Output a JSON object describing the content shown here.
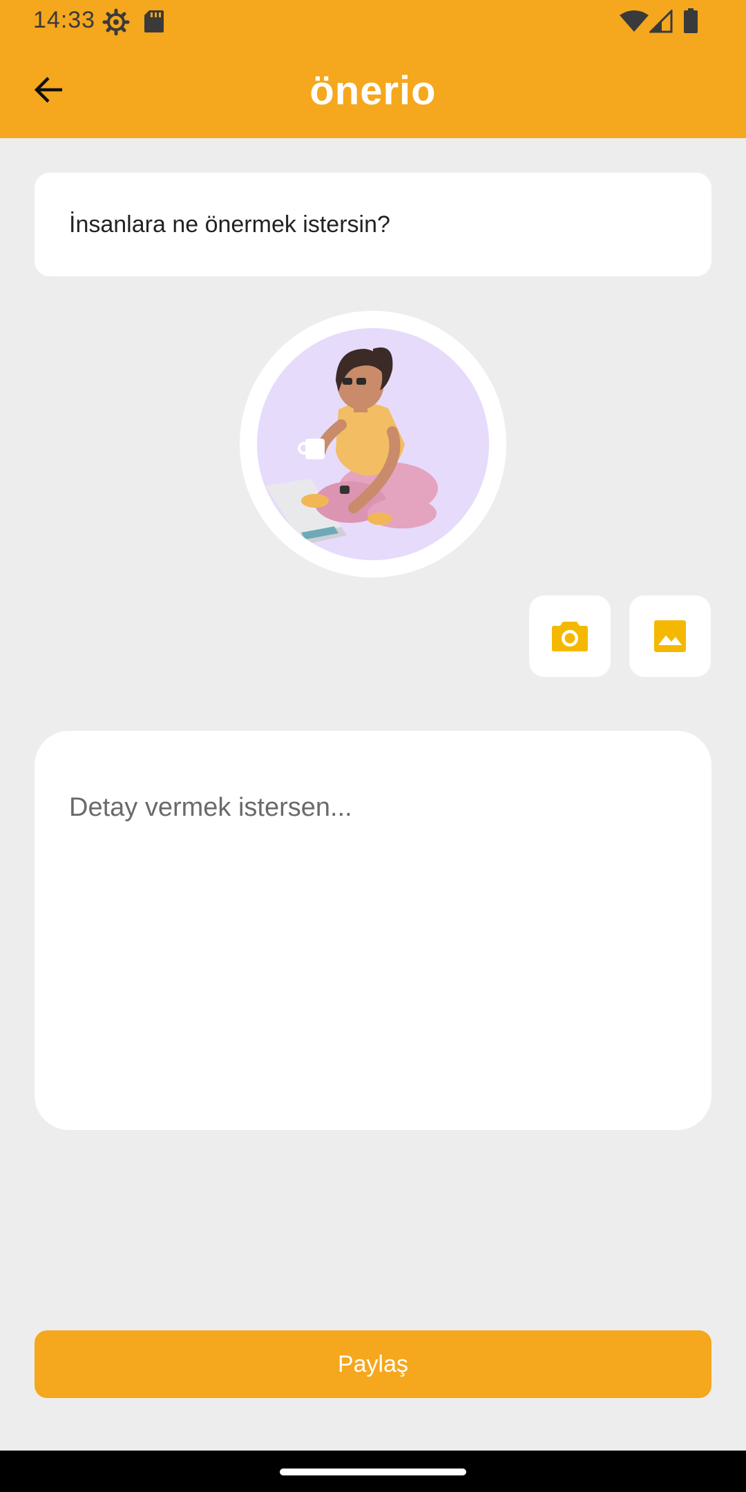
{
  "status_bar": {
    "time": "14:33",
    "icons": [
      "gear-icon",
      "sd-card-icon",
      "wifi-icon",
      "signal-icon",
      "battery-icon"
    ]
  },
  "header": {
    "title": "önerio",
    "back_icon": "arrow-left-icon",
    "background_color": "#F5A71D"
  },
  "form": {
    "title_placeholder": "İnsanlara ne önermek istersin?",
    "avatar": "illustration of woman with coffee and laptop",
    "camera_icon": "camera-icon",
    "gallery_icon": "image-icon",
    "detail_placeholder": "Detay vermek istersen...",
    "share_label": "Paylaş"
  },
  "colors": {
    "accent": "#F5A71D",
    "icon_accent": "#F5B800",
    "background": "#EDEDED"
  }
}
